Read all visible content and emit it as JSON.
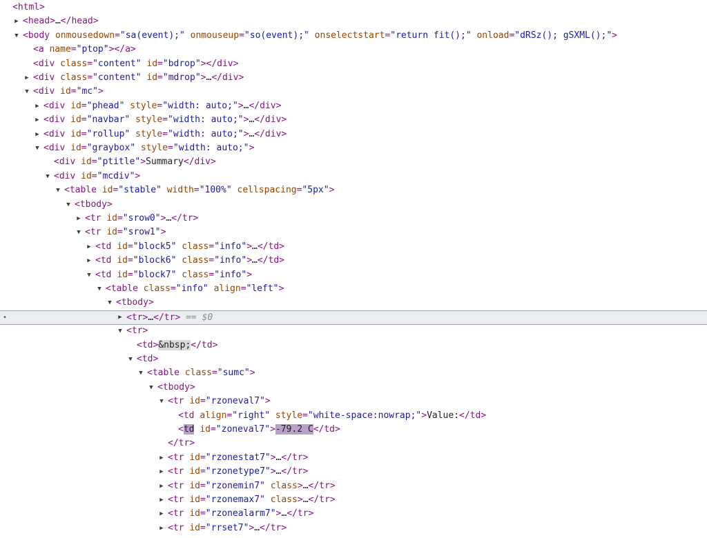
{
  "rows": [
    {
      "depth": 0,
      "toggle": "none",
      "tokens": [
        [
          "tag",
          "<html>"
        ]
      ]
    },
    {
      "depth": 1,
      "toggle": "collapsed",
      "tokens": [
        [
          "tag",
          "<head>"
        ],
        [
          "ell",
          "…"
        ],
        [
          "tag",
          "</head>"
        ]
      ]
    },
    {
      "depth": 1,
      "toggle": "expanded",
      "tokens": [
        [
          "tag",
          "<body "
        ],
        [
          "attr",
          "onmousedown"
        ],
        [
          "tag",
          "="
        ],
        [
          "val",
          "\"sa(event);\""
        ],
        [
          "txt",
          " "
        ],
        [
          "attr",
          "onmouseup"
        ],
        [
          "tag",
          "="
        ],
        [
          "val",
          "\"so(event);\""
        ],
        [
          "txt",
          " "
        ],
        [
          "attr",
          "onselectstart"
        ],
        [
          "tag",
          "="
        ],
        [
          "val",
          "\"return fit();\""
        ],
        [
          "txt",
          " "
        ],
        [
          "attr",
          "onload"
        ],
        [
          "tag",
          "="
        ],
        [
          "val",
          "\"dRSz(); gSXML();\""
        ],
        [
          "tag",
          ">"
        ]
      ]
    },
    {
      "depth": 2,
      "toggle": "none",
      "tokens": [
        [
          "tag",
          "<a "
        ],
        [
          "attr",
          "name"
        ],
        [
          "tag",
          "="
        ],
        [
          "val",
          "\"ptop\""
        ],
        [
          "tag",
          "></a>"
        ]
      ]
    },
    {
      "depth": 2,
      "toggle": "none",
      "tokens": [
        [
          "tag",
          "<div "
        ],
        [
          "attr",
          "class"
        ],
        [
          "tag",
          "="
        ],
        [
          "val",
          "\"content\""
        ],
        [
          "txt",
          " "
        ],
        [
          "attr",
          "id"
        ],
        [
          "tag",
          "="
        ],
        [
          "val",
          "\"bdrop\""
        ],
        [
          "tag",
          "></div>"
        ]
      ]
    },
    {
      "depth": 2,
      "toggle": "collapsed",
      "tokens": [
        [
          "tag",
          "<div "
        ],
        [
          "attr",
          "class"
        ],
        [
          "tag",
          "="
        ],
        [
          "val",
          "\"content\""
        ],
        [
          "txt",
          " "
        ],
        [
          "attr",
          "id"
        ],
        [
          "tag",
          "="
        ],
        [
          "val",
          "\"mdrop\""
        ],
        [
          "tag",
          ">"
        ],
        [
          "ell",
          "…"
        ],
        [
          "tag",
          "</div>"
        ]
      ]
    },
    {
      "depth": 2,
      "toggle": "expanded",
      "tokens": [
        [
          "tag",
          "<div "
        ],
        [
          "attr",
          "id"
        ],
        [
          "tag",
          "="
        ],
        [
          "val",
          "\"mc\""
        ],
        [
          "tag",
          ">"
        ]
      ]
    },
    {
      "depth": 3,
      "toggle": "collapsed",
      "tokens": [
        [
          "tag",
          "<div "
        ],
        [
          "attr",
          "id"
        ],
        [
          "tag",
          "="
        ],
        [
          "val",
          "\"phead\""
        ],
        [
          "txt",
          " "
        ],
        [
          "attr",
          "style"
        ],
        [
          "tag",
          "="
        ],
        [
          "val",
          "\"width: auto;\""
        ],
        [
          "tag",
          ">"
        ],
        [
          "ell",
          "…"
        ],
        [
          "tag",
          "</div>"
        ]
      ]
    },
    {
      "depth": 3,
      "toggle": "collapsed",
      "tokens": [
        [
          "tag",
          "<div "
        ],
        [
          "attr",
          "id"
        ],
        [
          "tag",
          "="
        ],
        [
          "val",
          "\"navbar\""
        ],
        [
          "txt",
          " "
        ],
        [
          "attr",
          "style"
        ],
        [
          "tag",
          "="
        ],
        [
          "val",
          "\"width: auto;\""
        ],
        [
          "tag",
          ">"
        ],
        [
          "ell",
          "…"
        ],
        [
          "tag",
          "</div>"
        ]
      ]
    },
    {
      "depth": 3,
      "toggle": "collapsed",
      "tokens": [
        [
          "tag",
          "<div "
        ],
        [
          "attr",
          "id"
        ],
        [
          "tag",
          "="
        ],
        [
          "val",
          "\"rollup\""
        ],
        [
          "txt",
          " "
        ],
        [
          "attr",
          "style"
        ],
        [
          "tag",
          "="
        ],
        [
          "val",
          "\"width: auto;\""
        ],
        [
          "tag",
          ">"
        ],
        [
          "ell",
          "…"
        ],
        [
          "tag",
          "</div>"
        ]
      ]
    },
    {
      "depth": 3,
      "toggle": "expanded",
      "tokens": [
        [
          "tag",
          "<div "
        ],
        [
          "attr",
          "id"
        ],
        [
          "tag",
          "="
        ],
        [
          "val",
          "\"graybox\""
        ],
        [
          "txt",
          " "
        ],
        [
          "attr",
          "style"
        ],
        [
          "tag",
          "="
        ],
        [
          "val",
          "\"width: auto;\""
        ],
        [
          "tag",
          ">"
        ]
      ]
    },
    {
      "depth": 4,
      "toggle": "none",
      "tokens": [
        [
          "tag",
          "<div "
        ],
        [
          "attr",
          "id"
        ],
        [
          "tag",
          "="
        ],
        [
          "val",
          "\"ptitle\""
        ],
        [
          "tag",
          ">"
        ],
        [
          "txt",
          "Summary"
        ],
        [
          "tag",
          "</div>"
        ]
      ]
    },
    {
      "depth": 4,
      "toggle": "expanded",
      "tokens": [
        [
          "tag",
          "<div "
        ],
        [
          "attr",
          "id"
        ],
        [
          "tag",
          "="
        ],
        [
          "val",
          "\"mcdiv\""
        ],
        [
          "tag",
          ">"
        ]
      ]
    },
    {
      "depth": 5,
      "toggle": "expanded",
      "tokens": [
        [
          "tag",
          "<table "
        ],
        [
          "attr",
          "id"
        ],
        [
          "tag",
          "="
        ],
        [
          "val",
          "\"stable\""
        ],
        [
          "txt",
          " "
        ],
        [
          "attr",
          "width"
        ],
        [
          "tag",
          "="
        ],
        [
          "val",
          "\"100%\""
        ],
        [
          "txt",
          " "
        ],
        [
          "attr",
          "cellspacing"
        ],
        [
          "tag",
          "="
        ],
        [
          "val",
          "\"5px\""
        ],
        [
          "tag",
          ">"
        ]
      ]
    },
    {
      "depth": 6,
      "toggle": "expanded",
      "tokens": [
        [
          "tag",
          "<tbody>"
        ]
      ]
    },
    {
      "depth": 7,
      "toggle": "collapsed",
      "tokens": [
        [
          "tag",
          "<tr "
        ],
        [
          "attr",
          "id"
        ],
        [
          "tag",
          "="
        ],
        [
          "val",
          "\"srow0\""
        ],
        [
          "tag",
          ">"
        ],
        [
          "ell",
          "…"
        ],
        [
          "tag",
          "</tr>"
        ]
      ]
    },
    {
      "depth": 7,
      "toggle": "expanded",
      "tokens": [
        [
          "tag",
          "<tr "
        ],
        [
          "attr",
          "id"
        ],
        [
          "tag",
          "="
        ],
        [
          "val",
          "\"srow1\""
        ],
        [
          "tag",
          ">"
        ]
      ]
    },
    {
      "depth": 8,
      "toggle": "collapsed",
      "tokens": [
        [
          "tag",
          "<td "
        ],
        [
          "attr",
          "id"
        ],
        [
          "tag",
          "="
        ],
        [
          "val",
          "\"block5\""
        ],
        [
          "txt",
          " "
        ],
        [
          "attr",
          "class"
        ],
        [
          "tag",
          "="
        ],
        [
          "val",
          "\"info\""
        ],
        [
          "tag",
          ">"
        ],
        [
          "ell",
          "…"
        ],
        [
          "tag",
          "</td>"
        ]
      ]
    },
    {
      "depth": 8,
      "toggle": "collapsed",
      "tokens": [
        [
          "tag",
          "<td "
        ],
        [
          "attr",
          "id"
        ],
        [
          "tag",
          "="
        ],
        [
          "val",
          "\"block6\""
        ],
        [
          "txt",
          " "
        ],
        [
          "attr",
          "class"
        ],
        [
          "tag",
          "="
        ],
        [
          "val",
          "\"info\""
        ],
        [
          "tag",
          ">"
        ],
        [
          "ell",
          "…"
        ],
        [
          "tag",
          "</td>"
        ]
      ]
    },
    {
      "depth": 8,
      "toggle": "expanded",
      "tokens": [
        [
          "tag",
          "<td "
        ],
        [
          "attr",
          "id"
        ],
        [
          "tag",
          "="
        ],
        [
          "val",
          "\"block7\""
        ],
        [
          "txt",
          " "
        ],
        [
          "attr",
          "class"
        ],
        [
          "tag",
          "="
        ],
        [
          "val",
          "\"info\""
        ],
        [
          "tag",
          ">"
        ]
      ]
    },
    {
      "depth": 9,
      "toggle": "expanded",
      "tokens": [
        [
          "tag",
          "<table "
        ],
        [
          "attr",
          "class"
        ],
        [
          "tag",
          "="
        ],
        [
          "val",
          "\"info\""
        ],
        [
          "txt",
          " "
        ],
        [
          "attr",
          "align"
        ],
        [
          "tag",
          "="
        ],
        [
          "val",
          "\"left\""
        ],
        [
          "tag",
          ">"
        ]
      ]
    },
    {
      "depth": 10,
      "toggle": "expanded",
      "tokens": [
        [
          "tag",
          "<tbody>"
        ]
      ]
    },
    {
      "depth": 11,
      "toggle": "collapsed",
      "selected": true,
      "tokens": [
        [
          "tag",
          "<tr>"
        ],
        [
          "ell",
          "…"
        ],
        [
          "tag",
          "</tr>"
        ],
        [
          "txt",
          " "
        ],
        [
          "eq",
          "== $0"
        ]
      ]
    },
    {
      "depth": 11,
      "toggle": "expanded",
      "tokens": [
        [
          "tag",
          "<tr>"
        ]
      ]
    },
    {
      "depth": 12,
      "toggle": "none",
      "tokens": [
        [
          "tag",
          "<td>"
        ],
        [
          "ent",
          "&nbsp;"
        ],
        [
          "tag",
          "</td>"
        ]
      ]
    },
    {
      "depth": 12,
      "toggle": "expanded",
      "tokens": [
        [
          "tag",
          "<td>"
        ]
      ]
    },
    {
      "depth": 13,
      "toggle": "expanded",
      "tokens": [
        [
          "tag",
          "<table "
        ],
        [
          "attr",
          "class"
        ],
        [
          "tag",
          "="
        ],
        [
          "val",
          "\"sumc\""
        ],
        [
          "tag",
          ">"
        ]
      ]
    },
    {
      "depth": 14,
      "toggle": "expanded",
      "tokens": [
        [
          "tag",
          "<tbody>"
        ]
      ]
    },
    {
      "depth": 15,
      "toggle": "expanded",
      "tokens": [
        [
          "tag",
          "<tr "
        ],
        [
          "attr",
          "id"
        ],
        [
          "tag",
          "="
        ],
        [
          "val",
          "\"rzoneval7\""
        ],
        [
          "tag",
          ">"
        ]
      ]
    },
    {
      "depth": 16,
      "toggle": "none",
      "tokens": [
        [
          "tag",
          "<td "
        ],
        [
          "attr",
          "align"
        ],
        [
          "tag",
          "="
        ],
        [
          "val",
          "\"right\""
        ],
        [
          "txt",
          " "
        ],
        [
          "attr",
          "style"
        ],
        [
          "tag",
          "="
        ],
        [
          "val",
          "\"white-space:nowrap;\""
        ],
        [
          "tag",
          ">"
        ],
        [
          "txt",
          "Value:"
        ],
        [
          "tag",
          "</td>"
        ]
      ]
    },
    {
      "depth": 16,
      "toggle": "none",
      "tokens": [
        [
          "tag",
          "<"
        ],
        [
          "hl",
          "td"
        ],
        [
          "txt",
          " "
        ],
        [
          "attr",
          "id"
        ],
        [
          "tag",
          "="
        ],
        [
          "val",
          "\"zoneval7\""
        ],
        [
          "tag",
          ">"
        ],
        [
          "hl",
          "-79.2 C"
        ],
        [
          "tag",
          "</td>"
        ]
      ]
    },
    {
      "depth": 15,
      "toggle": "none",
      "tokens": [
        [
          "tag",
          "</tr>"
        ]
      ]
    },
    {
      "depth": 15,
      "toggle": "collapsed",
      "tokens": [
        [
          "tag",
          "<tr "
        ],
        [
          "attr",
          "id"
        ],
        [
          "tag",
          "="
        ],
        [
          "val",
          "\"rzonestat7\""
        ],
        [
          "tag",
          ">"
        ],
        [
          "ell",
          "…"
        ],
        [
          "tag",
          "</tr>"
        ]
      ]
    },
    {
      "depth": 15,
      "toggle": "collapsed",
      "tokens": [
        [
          "tag",
          "<tr "
        ],
        [
          "attr",
          "id"
        ],
        [
          "tag",
          "="
        ],
        [
          "val",
          "\"rzonetype7\""
        ],
        [
          "tag",
          ">"
        ],
        [
          "ell",
          "…"
        ],
        [
          "tag",
          "</tr>"
        ]
      ]
    },
    {
      "depth": 15,
      "toggle": "collapsed",
      "tokens": [
        [
          "tag",
          "<tr "
        ],
        [
          "attr",
          "id"
        ],
        [
          "tag",
          "="
        ],
        [
          "val",
          "\"rzonemin7\""
        ],
        [
          "txt",
          " "
        ],
        [
          "attr",
          "class"
        ],
        [
          "tag",
          ">"
        ],
        [
          "ell",
          "…"
        ],
        [
          "tag",
          "</tr>"
        ]
      ]
    },
    {
      "depth": 15,
      "toggle": "collapsed",
      "tokens": [
        [
          "tag",
          "<tr "
        ],
        [
          "attr",
          "id"
        ],
        [
          "tag",
          "="
        ],
        [
          "val",
          "\"rzonemax7\""
        ],
        [
          "txt",
          " "
        ],
        [
          "attr",
          "class"
        ],
        [
          "tag",
          ">"
        ],
        [
          "ell",
          "…"
        ],
        [
          "tag",
          "</tr>"
        ]
      ]
    },
    {
      "depth": 15,
      "toggle": "collapsed",
      "tokens": [
        [
          "tag",
          "<tr "
        ],
        [
          "attr",
          "id"
        ],
        [
          "tag",
          "="
        ],
        [
          "val",
          "\"rzonealarm7\""
        ],
        [
          "tag",
          ">"
        ],
        [
          "ell",
          "…"
        ],
        [
          "tag",
          "</tr>"
        ]
      ]
    },
    {
      "depth": 15,
      "toggle": "collapsed",
      "tokens": [
        [
          "tag",
          "<tr "
        ],
        [
          "attr",
          "id"
        ],
        [
          "tag",
          "="
        ],
        [
          "val",
          "\"rrset7\""
        ],
        [
          "tag",
          ">"
        ],
        [
          "ell",
          "…"
        ],
        [
          "tag",
          "</tr>"
        ]
      ]
    }
  ],
  "selected_marker": "•"
}
